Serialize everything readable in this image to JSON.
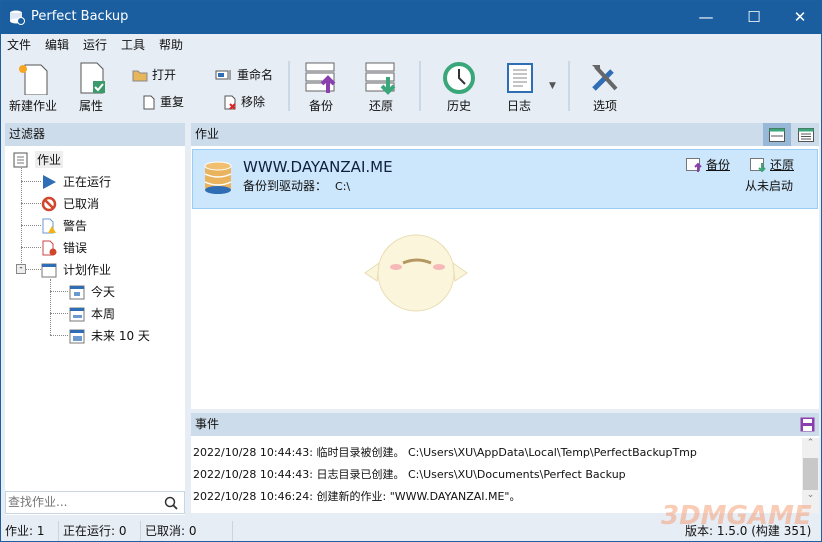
{
  "app": {
    "title": "Perfect Backup"
  },
  "menu": [
    "文件",
    "编辑",
    "运行",
    "工具",
    "帮助"
  ],
  "toolbar": {
    "new_job": "新建作业",
    "properties": "属性",
    "open": "打开",
    "duplicate": "重复",
    "rename": "重命名",
    "remove": "移除",
    "backup": "备份",
    "restore": "还原",
    "history": "历史",
    "log": "日志",
    "options": "选项"
  },
  "filters": {
    "title": "过滤器",
    "root": "作业",
    "items": [
      "正在运行",
      "已取消",
      "警告",
      "错误",
      "计划作业"
    ],
    "scheduled": [
      "今天",
      "本周",
      "未来 10 天"
    ]
  },
  "search": {
    "placeholder": "查找作业..."
  },
  "jobs": {
    "title": "作业",
    "list": [
      {
        "name": "WWW.DAYANZAI.ME",
        "target_label": "备份到驱动器：",
        "target": "C:\\",
        "backup_link": "备份",
        "restore_link": "还原",
        "status": "从未启动"
      }
    ]
  },
  "events": {
    "title": "事件",
    "rows": [
      "2022/10/28 10:44:43: 临时目录被创建。 C:\\Users\\XU\\AppData\\Local\\Temp\\PerfectBackupTmp",
      "2022/10/28 10:44:43: 日志目录已创建。 C:\\Users\\XU\\Documents\\Perfect Backup",
      "2022/10/28 10:46:24: 创建新的作业: \"WWW.DAYANZAI.ME\"。"
    ]
  },
  "status": {
    "jobs": "作业: 1",
    "running": "正在运行: 0",
    "cancelled": "已取消: 0",
    "version": "版本: 1.5.0 (构建 351)"
  },
  "watermark": "3DMGAME",
  "colors": {
    "titlebar": "#1b5e9f",
    "panel_header": "#cddcea",
    "selected": "#cce6fb"
  }
}
